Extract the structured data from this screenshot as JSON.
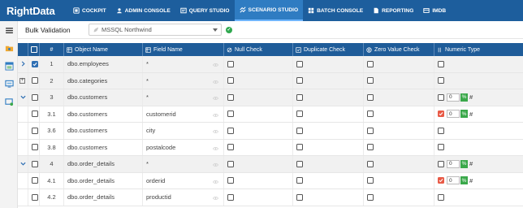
{
  "app": {
    "logo": "RightData"
  },
  "nav": {
    "tabs": [
      {
        "label": "COCKPIT",
        "icon": "cockpit-icon",
        "active": false
      },
      {
        "label": "ADMIN CONSOLE",
        "icon": "admin-console-icon",
        "active": false
      },
      {
        "label": "QUERY STUDIO",
        "icon": "query-studio-icon",
        "active": false
      },
      {
        "label": "SCENARIO STUDIO",
        "icon": "scenario-studio-icon",
        "active": true
      },
      {
        "label": "BATCH CONSOLE",
        "icon": "batch-console-icon",
        "active": false
      },
      {
        "label": "REPORTING",
        "icon": "reporting-icon",
        "active": false
      },
      {
        "label": "IMDB",
        "icon": "imdb-icon",
        "active": false
      }
    ]
  },
  "toolbar": {
    "title": "Bulk Validation",
    "connection": "MSSQL Northwind",
    "status_icon": "connection-ok-icon"
  },
  "table": {
    "headers": {
      "num": "#",
      "object": "Object Name",
      "field": "Field Name",
      "null": "Null Check",
      "dup": "Duplicate Check",
      "zero": "Zero Value Check",
      "numeric": "Numeric Type"
    },
    "rows": [
      {
        "expander": "chevron-right",
        "checked": true,
        "num": "1",
        "object": "dbo.employees",
        "field": "*",
        "numeric_checked": false,
        "numeric_value": "",
        "shaded": true
      },
      {
        "expander": "plus",
        "checked": false,
        "num": "2",
        "object": "dbo.categories",
        "field": "*",
        "numeric_checked": false,
        "numeric_value": "",
        "shaded": true
      },
      {
        "expander": "chevron-down",
        "checked": false,
        "num": "3",
        "object": "dbo.customers",
        "field": "*",
        "numeric_checked": false,
        "numeric_value": "0",
        "shaded": true
      },
      {
        "expander": "",
        "checked": false,
        "num": "3.1",
        "object": "dbo.customers",
        "field": "customerid",
        "numeric_checked": true,
        "numeric_value": "0",
        "shaded": false
      },
      {
        "expander": "",
        "checked": false,
        "num": "3.6",
        "object": "dbo.customers",
        "field": "city",
        "numeric_checked": false,
        "numeric_value": "",
        "shaded": false
      },
      {
        "expander": "",
        "checked": false,
        "num": "3.8",
        "object": "dbo.customers",
        "field": "postalcode",
        "numeric_checked": false,
        "numeric_value": "",
        "shaded": false
      },
      {
        "expander": "chevron-down",
        "checked": false,
        "num": "4",
        "object": "dbo.order_details",
        "field": "*",
        "numeric_checked": false,
        "numeric_value": "0",
        "shaded": true
      },
      {
        "expander": "",
        "checked": false,
        "num": "4.1",
        "object": "dbo.order_details",
        "field": "orderid",
        "numeric_checked": true,
        "numeric_value": "0",
        "shaded": false
      },
      {
        "expander": "",
        "checked": false,
        "num": "4.2",
        "object": "dbo.order_details",
        "field": "productid",
        "numeric_checked": false,
        "numeric_value": "",
        "shaded": false
      }
    ]
  },
  "colors": {
    "nav_bg": "#1d5e9d",
    "nav_active": "#2f7cc2",
    "header_bg": "#1f5c99",
    "ok_green": "#2fa84f",
    "check_red": "#e85a46",
    "check_blue": "#2f6fb3"
  }
}
